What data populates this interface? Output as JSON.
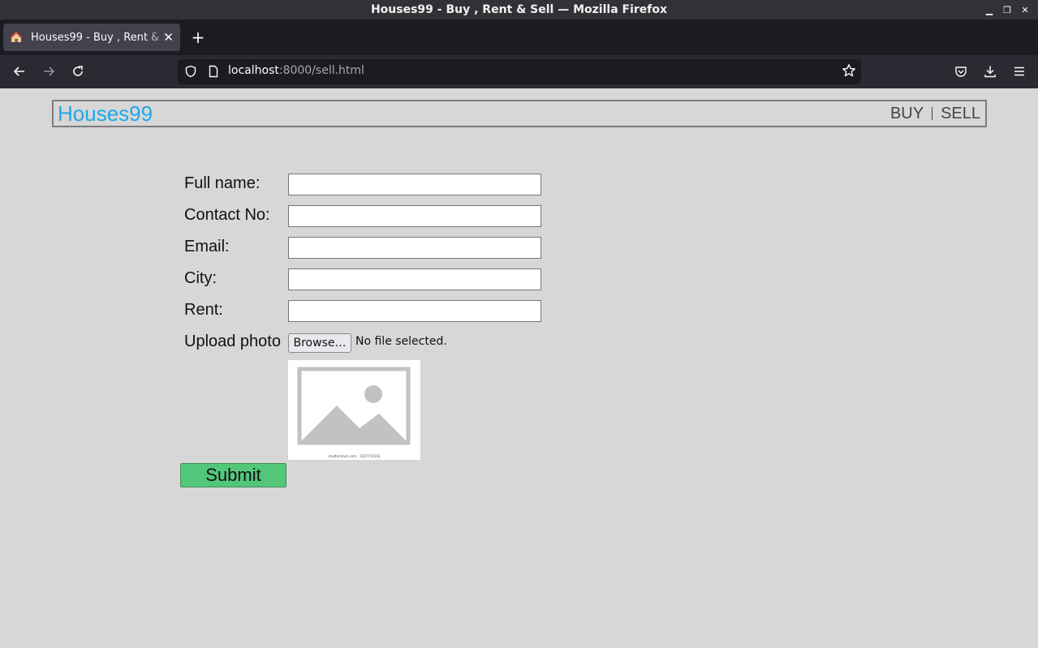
{
  "window": {
    "title": "Houses99 - Buy , Rent & Sell — Mozilla Firefox",
    "controls": [
      "minimize-icon",
      "maximize-icon",
      "close-icon"
    ]
  },
  "tabs": [
    {
      "title": "Houses99 - Buy , Rent & Sell",
      "favicon": "house-icon",
      "active": true
    }
  ],
  "toolbar": {
    "new_tab_icon": "plus-icon",
    "back_icon": "arrow-left-icon",
    "forward_icon": "arrow-right-icon",
    "reload_icon": "reload-icon",
    "url_host": "localhost",
    "url_rest": ":8000/sell.html",
    "bookmark_icon": "star-icon",
    "pocket_icon": "pocket-icon",
    "downloads_icon": "download-icon",
    "menu_icon": "hamburger-menu-icon"
  },
  "site": {
    "logo": "Houses99",
    "nav": {
      "buy": "BUY",
      "sell": "SELL"
    },
    "logo_color": "#1ea9e8"
  },
  "form": {
    "fields": [
      {
        "label": "Full name:",
        "value": ""
      },
      {
        "label": "Contact No:",
        "value": ""
      },
      {
        "label": "Email:",
        "value": ""
      },
      {
        "label": "City:",
        "value": ""
      },
      {
        "label": "Rent:",
        "value": ""
      }
    ],
    "upload": {
      "label": "Upload photo",
      "button": "Browse…",
      "status": "No file selected."
    },
    "placeholder_image": {
      "icon": "image-placeholder-icon",
      "credit": "shutterstock.com · 1037719192"
    },
    "submit": "Submit",
    "submit_color": "#52c77a"
  }
}
